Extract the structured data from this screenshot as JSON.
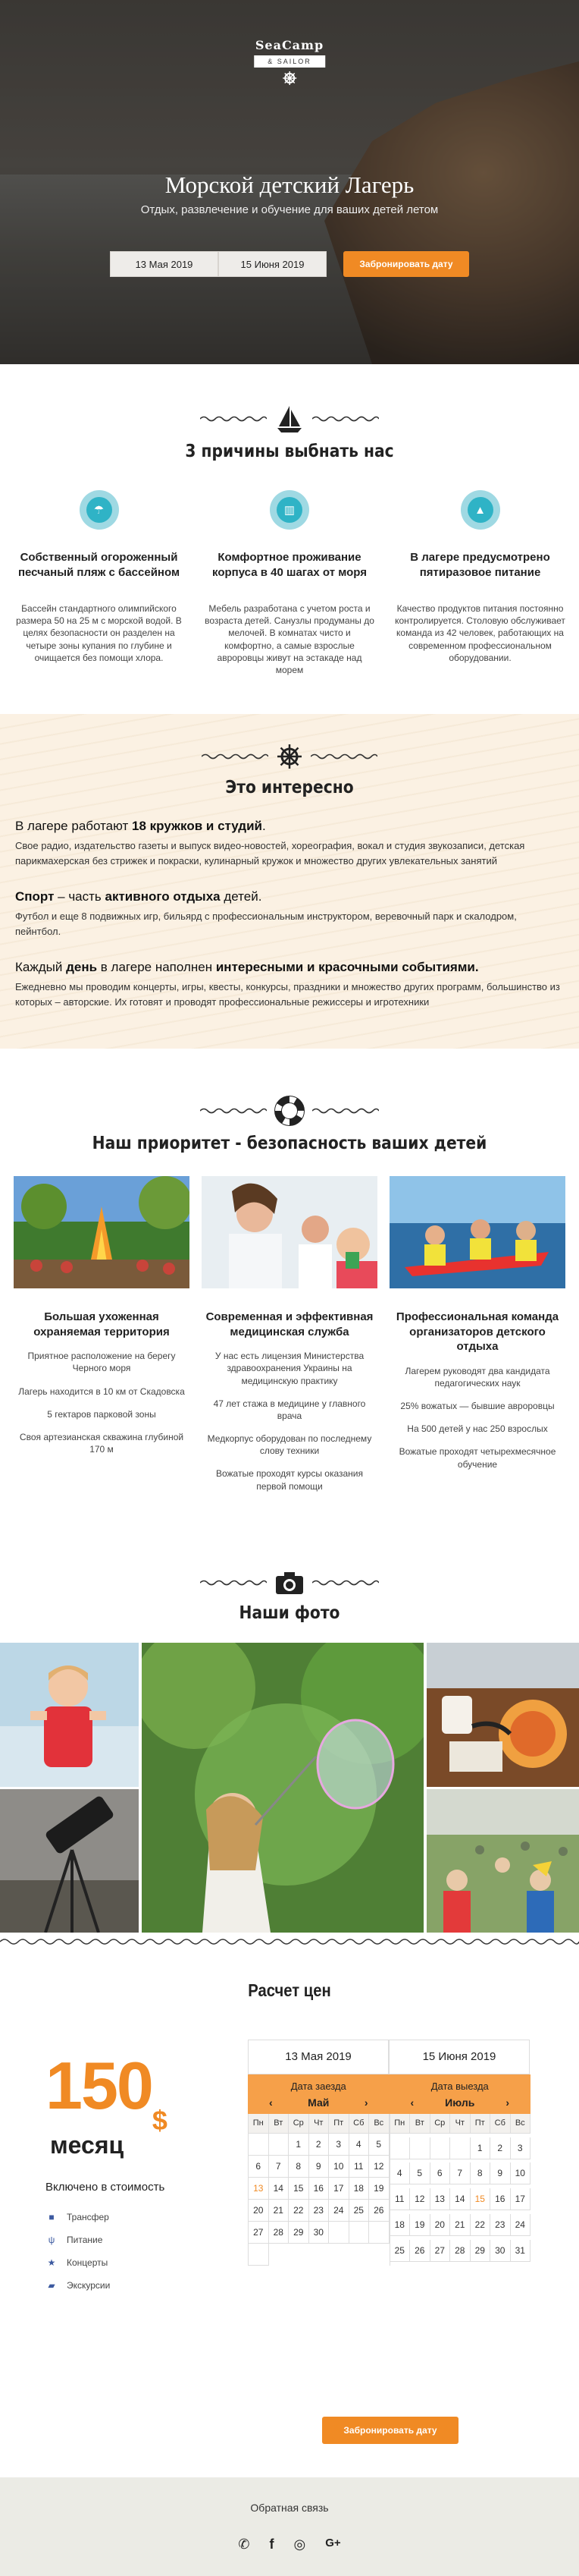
{
  "hero": {
    "logo_line1": "SeaCamp",
    "logo_line2": "& SAILOR",
    "title": "Морской детский Лагерь",
    "subtitle": "Отдых, развлечение и обучение для ваших детей летом",
    "date_from": "13 Мая 2019",
    "date_to": "15 Июня 2019",
    "book_label": "Забронировать дату"
  },
  "reasons": {
    "title": "3 причины выбнать нас",
    "items": [
      {
        "icon": "beach-umbrella-icon",
        "title": "Собственный огороженный песчаный пляж с бассейном",
        "text": "Бассейн стандартного олимпийского размера 50 на 25 м с морской водой. В целях безопасности он разделен на четыре зоны купания по глубине и очищается без помощи хлора."
      },
      {
        "icon": "building-icon",
        "title": "Комфортное проживание корпуса в 40 шагах от моря",
        "text": "Мебель разработана с учетом роста и возраста детей. Санузлы продуманы до мелочей. В комнатах чисто и комфортно, а самые взрослые авроровцы живут на эстакаде над морем"
      },
      {
        "icon": "food-icon",
        "title": "В лагере предусмотрено пятиразовое питание",
        "text": "Качество продуктов питания постоянно контролируется. Столовую обслуживает команда из 42 человек, работающих на современном профессиональном оборудовании."
      }
    ]
  },
  "interest": {
    "title": "Это интересно",
    "blocks": [
      {
        "h_pre": "В лагере ",
        "h_mid": "работают ",
        "h_bold": "18 кружков и студий",
        "h_post": ".",
        "p": "Свое радио, издательство газеты и выпуск видео-новостей, хореография, вокал и студия звукозаписи, детская парикмахерская без стрижек и покраски, кулинарный кружок и множество других увлекательных занятий"
      },
      {
        "h_pre": "Спорт",
        "h_mid": " – часть ",
        "h_bold": "активного отдыха",
        "h_post": " детей.",
        "p": "Футбол и еще 8 подвижных игр, бильярд с профессиональным инструктором, веревочный парк и скалодром, пейнтбол."
      },
      {
        "h_pre": "Каждый ",
        "h_mid": "день",
        "h_bold": " в лагере наполнен ",
        "h_post": "интересными и красочными событиями.",
        "p": "Ежедневно мы проводим концерты, игры, квесты, конкурсы, праздники и множество других программ, большинство из которых – авторские. Их готовят и проводят профессиональные режиссеры и игротехники"
      }
    ]
  },
  "safety": {
    "title": "Наш приоритет - безопасность ваших детей",
    "cols": [
      {
        "title": "Большая ухоженная охраняемая территория",
        "items": [
          "Приятное расположение на берегу Черного моря",
          "Лагерь находится в 10 км от Скадовска",
          "5 гектаров парковой зоны",
          "Своя артезианская скважина глубиной 170 м"
        ]
      },
      {
        "title": "Современная и эффективная медицинская служба",
        "items": [
          "У нас есть лицензия Министерства здравоохранения Украины на медицинскую практику",
          "47 лет стажа в медицине у главного врача",
          "Медкорпус оборудован по последнему слову техники",
          "Вожатые проходят курсы оказания первой помощи"
        ]
      },
      {
        "title": "Профессиональная команда организаторов детского отдыха",
        "items": [
          "Лагерем руководят два кандидата педагогических наук",
          "25% вожатых — бывшие авроровцы",
          "На 500 детей у нас 250 взрослых",
          "Вожатые проходят четырехмесячное обучение"
        ]
      }
    ]
  },
  "photos": {
    "title": "Наши фото"
  },
  "price": {
    "title": "Расчет цен",
    "amount": "150",
    "currency": "$",
    "period": "месяц",
    "included_title": "Включено в стоимость",
    "included": [
      {
        "icon": "bus-icon",
        "label": "Трансфер"
      },
      {
        "icon": "utensils-icon",
        "label": "Питание"
      },
      {
        "icon": "star-icon",
        "label": "Концерты"
      },
      {
        "icon": "map-icon",
        "label": "Экскурсии"
      }
    ],
    "date_from": "13 Мая 2019",
    "date_to": "15 Июня 2019",
    "arrival_label": "Дата заезда",
    "departure_label": "Дата выезда",
    "month_left": "Май",
    "month_right": "Июль",
    "weekdays": [
      "Пн",
      "Вт",
      "Ср",
      "Чт",
      "Пт",
      "Сб",
      "Вс"
    ],
    "left_days": [
      "",
      "",
      "1",
      "2",
      "3",
      "4",
      "5",
      "6",
      "7",
      "8",
      "9",
      "10",
      "11",
      "12",
      "13",
      "14",
      "15",
      "16",
      "17",
      "18",
      "19",
      "20",
      "21",
      "22",
      "23",
      "24",
      "25",
      "26",
      "27",
      "28",
      "29",
      "30",
      "",
      "",
      "",
      ""
    ],
    "right_days": [
      "",
      "",
      "",
      "",
      "1",
      "2",
      "3",
      "4",
      "5",
      "6",
      "7",
      "8",
      "9",
      "10",
      "11",
      "12",
      "13",
      "14",
      "15",
      "16",
      "17",
      "18",
      "19",
      "20",
      "21",
      "22",
      "23",
      "24",
      "25",
      "26",
      "27",
      "28",
      "29",
      "30",
      "31"
    ],
    "left_selected": "13",
    "right_selected": "15",
    "book_label": "Забронировать дату"
  },
  "footer": {
    "feedback": "Обратная связь",
    "socials": [
      "whatsapp-icon",
      "facebook-icon",
      "instagram-icon",
      "google-plus-icon"
    ]
  },
  "colors": {
    "accent": "#f08a24",
    "teal": "#2fb3c6",
    "sand": "#fbf1e3"
  }
}
